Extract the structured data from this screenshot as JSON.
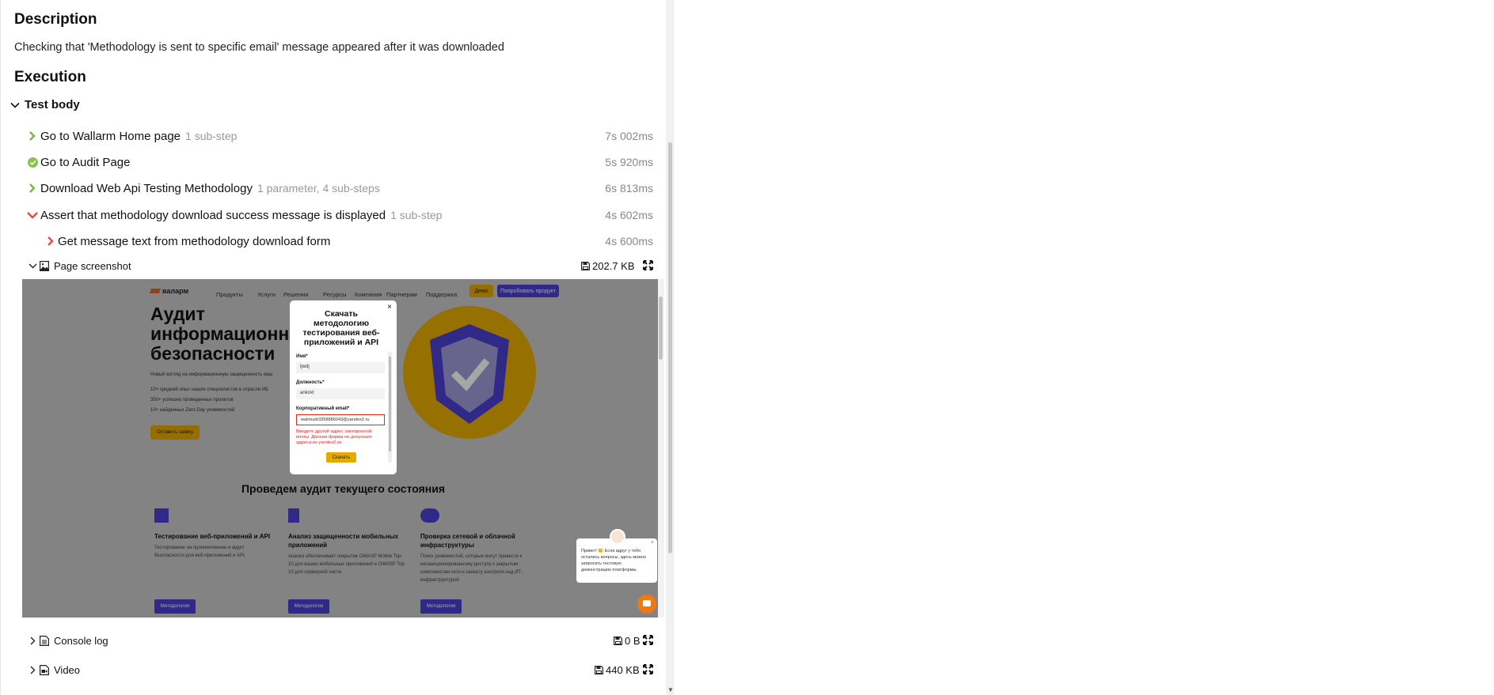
{
  "description": {
    "heading": "Description",
    "text": "Checking that 'Methodology is sent to specific email' message appeared after it was downloaded"
  },
  "execution": {
    "heading": "Execution",
    "test_body_label": "Test body",
    "steps": [
      {
        "name": "Go to Wallarm Home page",
        "meta": "1 sub-step",
        "duration": "7s 002ms",
        "status": "passed",
        "icon": "chevron-right-icon"
      },
      {
        "name": "Go to Audit Page",
        "meta": "",
        "duration": "5s 920ms",
        "status": "passed",
        "icon": "check-circle-icon"
      },
      {
        "name": "Download Web Api Testing Methodology",
        "meta": "1 parameter, 4 sub-steps",
        "duration": "6s 813ms",
        "status": "passed",
        "icon": "chevron-right-icon"
      },
      {
        "name": "Assert that methodology download success message is displayed",
        "meta": "1 sub-step",
        "duration": "4s 602ms",
        "status": "failed",
        "icon": "chevron-down-icon"
      },
      {
        "name": "Get message text from methodology download form",
        "meta": "",
        "duration": "4s 600ms",
        "status": "failed",
        "icon": "chevron-right-icon"
      }
    ],
    "attachments": [
      {
        "label": "Page screenshot",
        "size": "202.7 KB",
        "expanded": true,
        "icon": "image-file-icon"
      },
      {
        "label": "Console log",
        "size": "0 B",
        "expanded": false,
        "icon": "text-file-icon"
      },
      {
        "label": "Video",
        "size": "440 KB",
        "expanded": false,
        "icon": "video-file-icon"
      }
    ]
  },
  "screenshot": {
    "logo": "валарм",
    "nav": [
      "Продукты",
      "Услуги",
      "Решения",
      "Ресурсы",
      "Компания",
      "Партнерам",
      "Поддержка"
    ],
    "nav_demo": "Демо",
    "nav_try": "Попробовать продукт",
    "hero_title": "Аудит информационной безопасности",
    "hero_sub": "Новый взгляд на информационную защищенность ваш",
    "hero_bullets": [
      "10+ средний опыт наших специалистов в отрасли ИБ",
      "350+ успешно проведенных проектов",
      "10+ найденных Zero-Day уязвимостей"
    ],
    "hero_button": "Оставить заявку",
    "section_title": "Проведем аудит текущего состояния",
    "cards": [
      {
        "title": "Тестирование веб-приложений и API",
        "text": "Тестирование на проникновение и аудит безопасности для веб-приложений и API.",
        "button": "Методология"
      },
      {
        "title": "Анализ защищенности мобильных приложений",
        "text": "Анализ обеспечивает покрытие OWASP Mobile Top-10 для ваших мобильных приложений и OWASP Top 10 для серверной части",
        "button": "Методология"
      },
      {
        "title": "Проверка сетевой и облачной инфраструктуры",
        "text": "Поиск уязвимостей, которые могут привести к несанкционированному доступу к закрытым компонентам сети и захвату контроля над ИТ-инфраструктурой",
        "button": "Методология"
      }
    ],
    "modal": {
      "title": "Скачать методологию тестирования веб-приложений и API",
      "close": "×",
      "name_label": "Имя*",
      "name_value": "ljwdj",
      "position_label": "Должность*",
      "position_value": "ankoxl",
      "email_label": "Корпоративный email*",
      "email_value": "walmusb3358886043@yandex2.ru",
      "error": "Введите другой адрес электронной почты. Данная форма не допускает адреса из yandex2.ru",
      "button": "Скачать"
    },
    "chat": {
      "text": "Привет! 😊 Если вдруг у тебя остались вопросы, здесь можно запросить тестовую демонстрацию платформы.",
      "close": "×"
    }
  },
  "colors": {
    "passed": "#8bc34a",
    "failed": "#e74c3c",
    "accent_yellow": "#e6a900",
    "accent_blue": "#4b3fd1"
  }
}
